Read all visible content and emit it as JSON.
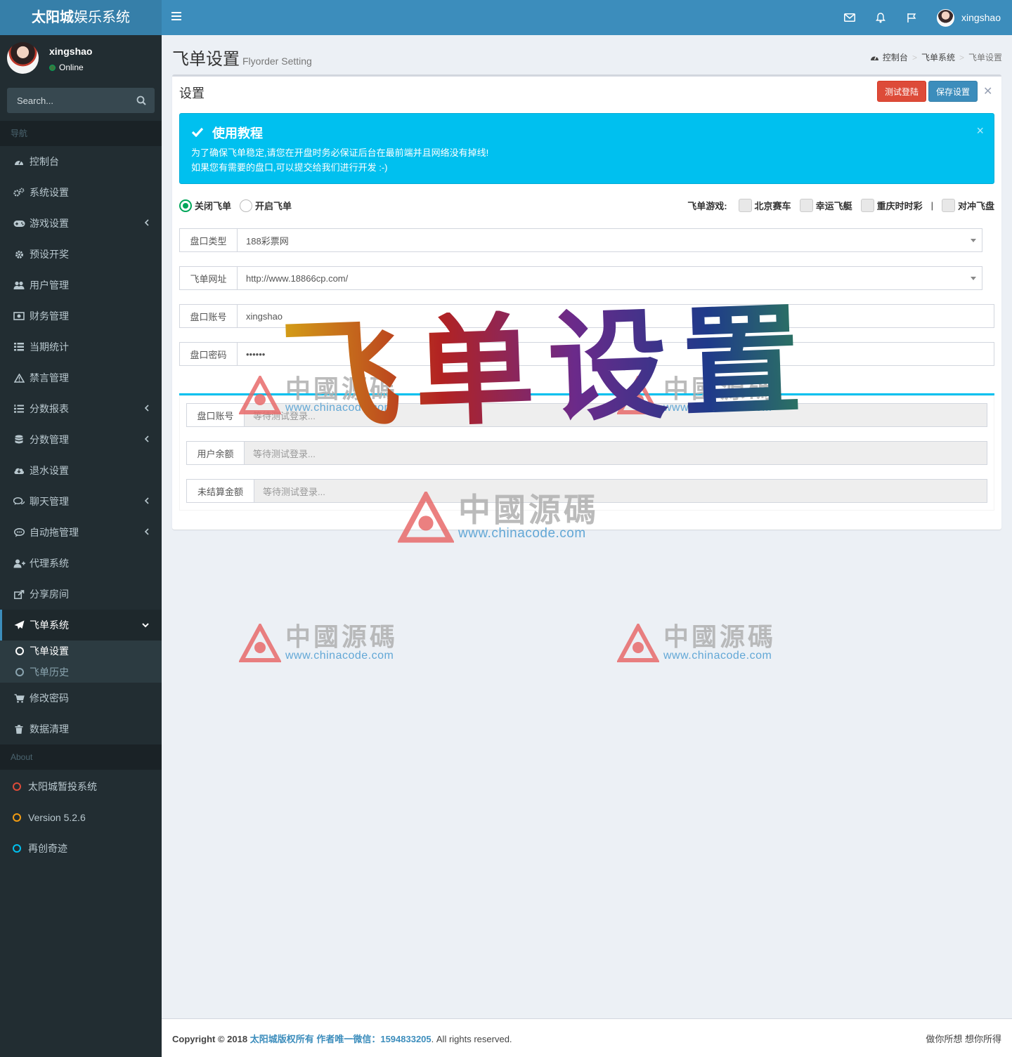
{
  "app": {
    "logo_bold": "太阳城",
    "logo_rest": "娱乐系统"
  },
  "topnav": {
    "username": "xingshao"
  },
  "sidebar": {
    "user": {
      "name": "xingshao",
      "status": "Online"
    },
    "search_placeholder": "Search...",
    "nav_header": "导航",
    "items": [
      {
        "label": "控制台",
        "icon": "dashboard-icon"
      },
      {
        "label": "系统设置",
        "icon": "cogs-icon"
      },
      {
        "label": "游戏设置",
        "icon": "gamepad-icon",
        "expandable": true
      },
      {
        "label": "预设开奖",
        "icon": "gear-icon"
      },
      {
        "label": "用户管理",
        "icon": "users-icon"
      },
      {
        "label": "财务管理",
        "icon": "money-icon"
      },
      {
        "label": "当期统计",
        "icon": "list-icon"
      },
      {
        "label": "禁言管理",
        "icon": "warning-icon"
      },
      {
        "label": "分数报表",
        "icon": "list-ol-icon",
        "expandable": true
      },
      {
        "label": "分数管理",
        "icon": "database-icon",
        "expandable": true
      },
      {
        "label": "退水设置",
        "icon": "cloud-download-icon"
      },
      {
        "label": "聊天管理",
        "icon": "comments-icon",
        "expandable": true
      },
      {
        "label": "自动拖管理",
        "icon": "commenting-icon",
        "expandable": true
      },
      {
        "label": "代理系统",
        "icon": "user-plus-icon"
      },
      {
        "label": "分享房间",
        "icon": "share-icon"
      },
      {
        "label": "飞单系统",
        "icon": "paper-plane-icon",
        "active": true
      }
    ],
    "submenu": [
      {
        "label": "飞单设置",
        "current": true
      },
      {
        "label": "飞单历史",
        "current": false
      }
    ],
    "items_after": [
      {
        "label": "修改密码",
        "icon": "cart-icon"
      },
      {
        "label": "数据清理",
        "icon": "trash-icon"
      }
    ],
    "about_header": "About",
    "about": [
      {
        "label": "太阳城暂投系统",
        "color": "#dd4b39"
      },
      {
        "label": "Version 5.2.6",
        "color": "#f39c12"
      },
      {
        "label": "再创奇迹",
        "color": "#00c0ef"
      }
    ]
  },
  "page": {
    "title": "飞单设置",
    "subtitle": "Flyorder Setting",
    "breadcrumb": [
      "控制台",
      "飞单系统",
      "飞单设置"
    ]
  },
  "box": {
    "title": "设置",
    "btn_test": "测试登陆",
    "btn_save": "保存设置",
    "callout": {
      "title": "使用教程",
      "line1": "为了确保飞单稳定,请您在开盘时务必保证后台在最前端并且网络没有掉线!",
      "line2": "如果您有需要的盘口,可以提交给我们进行开发 :-)"
    },
    "radios": [
      {
        "label": "关闭飞单",
        "checked": true
      },
      {
        "label": "开启飞单",
        "checked": false
      }
    ],
    "games_label": "飞单游戏:",
    "games": [
      "北京赛车",
      "幸运飞艇",
      "重庆时时彩",
      "对冲飞盘"
    ],
    "fields": [
      {
        "label": "盘口类型",
        "value": "188彩票网",
        "type": "select"
      },
      {
        "label": "飞单网址",
        "value": "http://www.18866cp.com/",
        "type": "select"
      },
      {
        "label": "盘口账号",
        "value": "xingshao",
        "type": "text"
      },
      {
        "label": "盘口密码",
        "value": "••••••",
        "type": "password"
      }
    ],
    "status_fields": [
      {
        "label": "盘口账号",
        "placeholder": "等待测试登录..."
      },
      {
        "label": "用户余额",
        "placeholder": "等待测试登录..."
      },
      {
        "label": "未结算金额",
        "placeholder": "等待测试登录..."
      }
    ]
  },
  "watermark": {
    "big": "飞单设置",
    "brand": "中國源碼",
    "url": "www.chinacode.com"
  },
  "footer": {
    "copyright": "Copyright © 2018",
    "link": "太阳城版权所有 作者唯一微信：1594833205",
    "rights": ". All rights reserved.",
    "right": "做你所想 想你所得"
  },
  "colors": {
    "logo_bg": "#367fa9",
    "navbar_bg": "#3c8dbc",
    "sidebar_bg": "#222d32",
    "callout_bg": "#00c0ef",
    "btn_test": "#dd4b39",
    "btn_save": "#3c8dbc"
  }
}
